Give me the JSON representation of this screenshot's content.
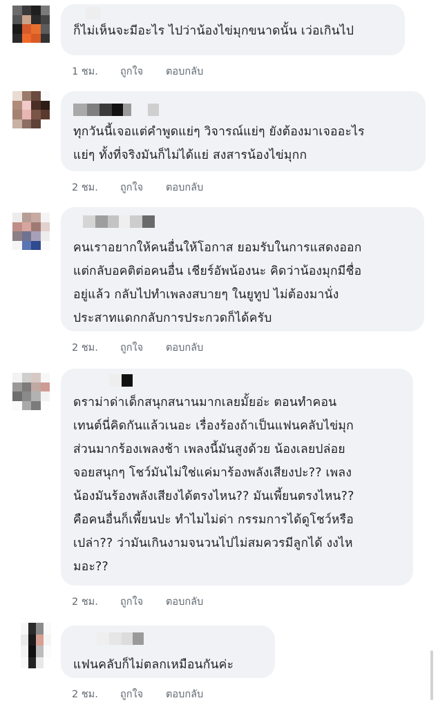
{
  "comments": [
    {
      "text": "ก็ไม่เห็นจะมีอะไร ไปว่าน้องไข่มุกขนาดนั้น เว่อเกินไป",
      "time": "1 ชม.",
      "like": "ถูกใจ",
      "reply": "ตอบกลับ"
    },
    {
      "text": "ทุกวันนี้เจอแต่คำพูดแย่ๆ วิจารณ์แย่ๆ ยังต้องมาเจออะไร\nแย่ๆ ทั้งที่จริงมันก็ไม่ได้แย่ สงสารน้องไข่มุกก",
      "time": "2 ชม.",
      "like": "ถูกใจ",
      "reply": "ตอบกลับ"
    },
    {
      "text": "คนเราอยากให้คนอื่นให้โอกาส ยอมรับในการแสดงออก\nแต่กลับอคติต่อคนอื่น เชียร์อัพน้องนะ คิดว่าน้องมุกมีชื่อ\nอยู่แล้ว กลับไปทำเพลงสบายๆ ในยูทูป ไม่ต้องมานั่ง\nประสาทแดกกลับการประกวดก็ได้ครับ",
      "time": "2 ชม.",
      "like": "ถูกใจ",
      "reply": "ตอบกลับ"
    },
    {
      "text": "ดราม่าด่าเด็กสนุกสนานมากเลยมั้ยอ่ะ ตอนทำคอน\nเทนต์นี่คิดกันแล้วเนอะ เรื่องร้องถ้าเป็นแฟนคลับไข่มุก\nส่วนมากร้องเพลงช้า เพลงนี้มันสูงด้วย น้องเลยปล่อย\nจอยสนุกๆ โชว์มันไม่ใช่แค่มาร้องพลังเสียงปะ?? เพลง\nน้องมันร้องพลังเสียงได้ตรงไหน?? มันเพี้ยนตรงไหน??\nคือคนอื่นก็เพี้ยนปะ ทำไมไม่ด่า กรรมการได้ดูโชว์หรือ\nเปล่า?? ว่ามันเกินงามจนวนไปไม่สมควรมีลูกได้ งงไห\nมอะ??",
      "time": "2 ชม.",
      "like": "ถูกใจ",
      "reply": "ตอบกลับ"
    },
    {
      "text": "แฟนคลับก็ไม่ตลกเหมือนกันค่ะ",
      "time": "2 ชม.",
      "like": "ถูกใจ",
      "reply": "ตอบกลับ"
    }
  ]
}
